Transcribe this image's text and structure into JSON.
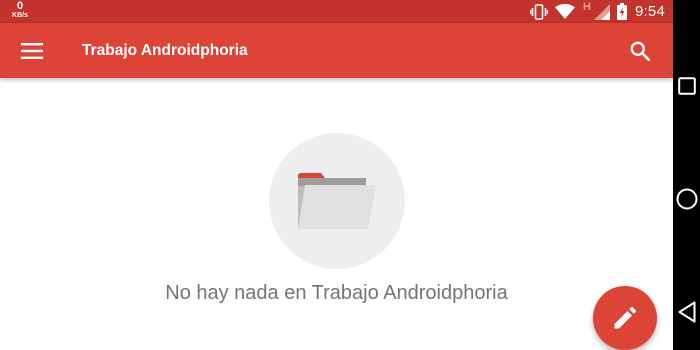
{
  "status_bar": {
    "net_speed_value": "0",
    "net_speed_unit": "KB/s",
    "network_type": "H",
    "time": "9:54",
    "icons": [
      "vibrate-icon",
      "wifi-icon",
      "cell-signal-icon",
      "battery-icon"
    ]
  },
  "app_bar": {
    "title": "Trabajo Androidphoria",
    "menu_icon": "hamburger-menu-icon",
    "search_icon": "search-icon"
  },
  "empty_state": {
    "icon": "folder-icon",
    "message": "No hay nada en Trabajo Androidphoria"
  },
  "fab": {
    "icon": "pencil-icon"
  },
  "nav_bar": {
    "buttons": [
      "recents-icon",
      "home-icon",
      "back-icon"
    ]
  },
  "colors": {
    "status_bar": "#c1332b",
    "app_bar": "#db4437",
    "fab": "#db4437",
    "empty_circle": "#eeeeee",
    "message_text": "#757575",
    "folder_tab": "#db4437",
    "folder_body": "#e0e0e0"
  }
}
